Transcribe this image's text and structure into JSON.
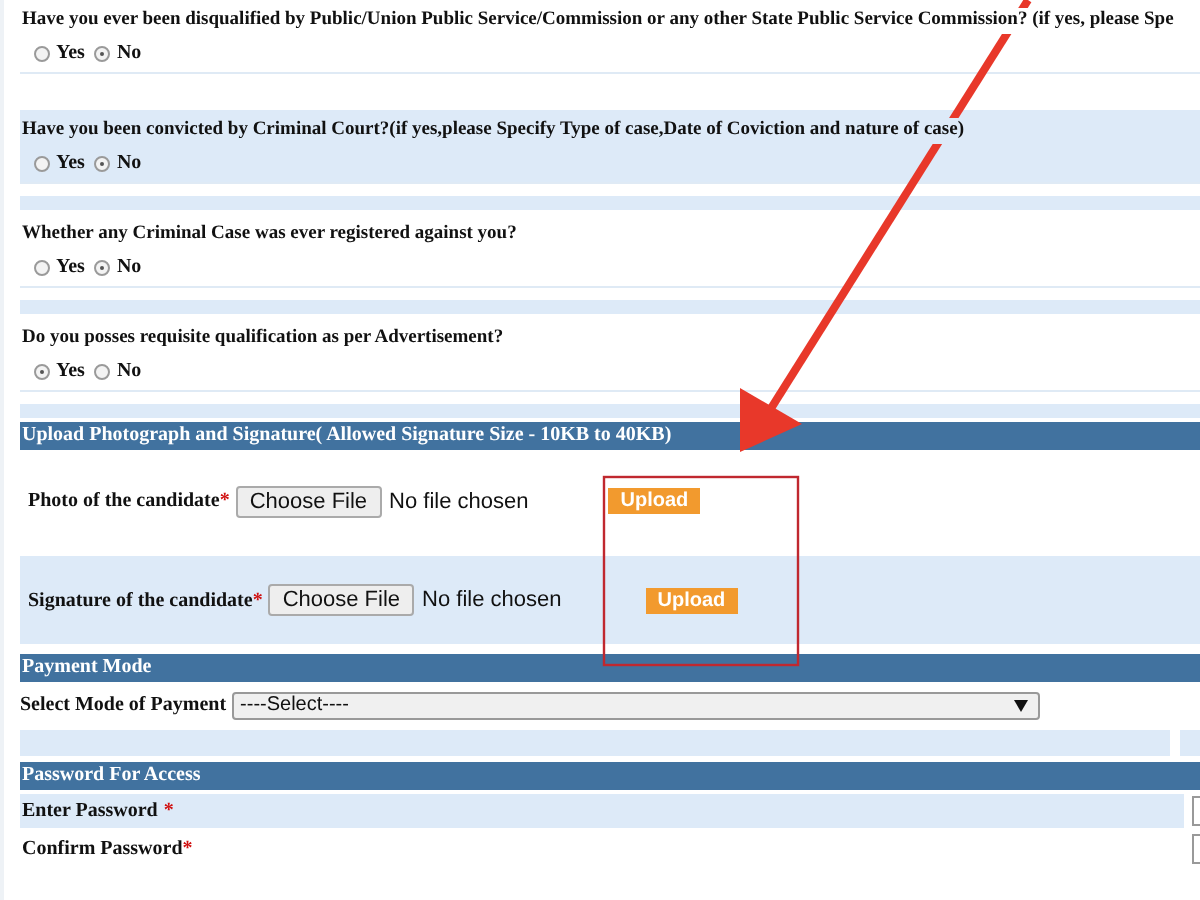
{
  "questions": [
    {
      "text": "Have you ever been disqualified by Public/Union Public Service/Commission or any other State Public Service Commission? (if yes, please Spe",
      "band": false,
      "options": [
        {
          "label": "Yes",
          "selected": false
        },
        {
          "label": "No",
          "selected": true
        }
      ]
    },
    {
      "text": "Have you been convicted by Criminal Court?(if yes,please Specify Type of case,Date of Coviction and nature of case)",
      "band": true,
      "options": [
        {
          "label": "Yes",
          "selected": false
        },
        {
          "label": "No",
          "selected": true
        }
      ]
    },
    {
      "text": "Whether any Criminal Case was ever registered against you?",
      "band": false,
      "options": [
        {
          "label": "Yes",
          "selected": false
        },
        {
          "label": "No",
          "selected": true
        }
      ]
    },
    {
      "text": "Do you posses requisite qualification as per Advertisement?",
      "band": false,
      "options": [
        {
          "label": "Yes",
          "selected": true
        },
        {
          "label": "No",
          "selected": false
        }
      ]
    }
  ],
  "upload": {
    "title": "Upload Photograph and Signature( Allowed Signature Size - 10KB to 40KB)",
    "rows": [
      {
        "label": "Photo of the candidate",
        "required": "*",
        "button": "Choose File",
        "status": "No file chosen",
        "action": "Upload"
      },
      {
        "label": "Signature of the candidate",
        "required": "*",
        "button": "Choose File",
        "status": "No file chosen",
        "action": "Upload"
      }
    ]
  },
  "payment": {
    "title": "Payment Mode",
    "label": "Select Mode of Payment",
    "select": "----Select----"
  },
  "password": {
    "title": "Password For Access",
    "fields": [
      {
        "label": "Enter Password",
        "required": "*"
      },
      {
        "label": "Confirm Password",
        "required": "*"
      }
    ]
  }
}
